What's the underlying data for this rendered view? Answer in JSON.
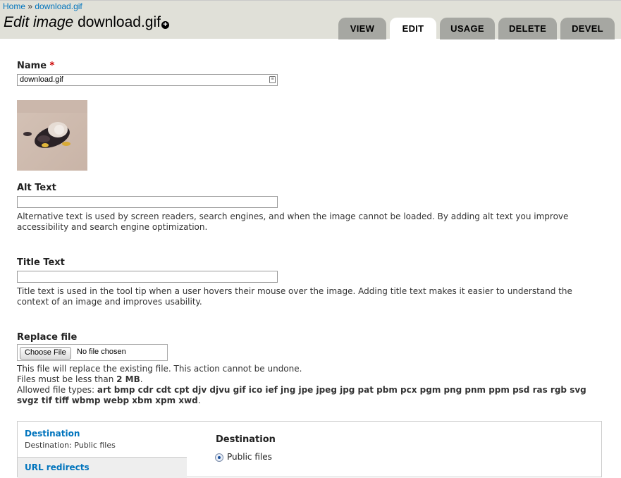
{
  "breadcrumb": {
    "home": "Home",
    "separator": " » ",
    "current": "download.gif"
  },
  "title": {
    "prefix": "Edit image",
    "name": "download.gif",
    "shortcut_symbol": "+"
  },
  "tabs": [
    {
      "label": "VIEW",
      "active": false
    },
    {
      "label": "EDIT",
      "active": true
    },
    {
      "label": "USAGE",
      "active": false
    },
    {
      "label": "DELETE",
      "active": false
    },
    {
      "label": "DEVEL",
      "active": false
    }
  ],
  "name_field": {
    "label": "Name",
    "required_mark": "*",
    "value": "download.gif",
    "icon": "contact-card-icon"
  },
  "alt_field": {
    "label": "Alt Text",
    "value": "",
    "description": "Alternative text is used by screen readers, search engines, and when the image cannot be loaded. By adding alt text you improve accessibility and search engine optimization."
  },
  "title_field": {
    "label": "Title Text",
    "value": "",
    "description": "Title text is used in the tool tip when a user hovers their mouse over the image. Adding title text makes it easier to understand the context of an image and improves usability."
  },
  "replace_file": {
    "label": "Replace file",
    "button": "Choose File",
    "status": "No file chosen",
    "help_line1": "This file will replace the existing file. This action cannot be undone.",
    "help_size_prefix": "Files must be less than ",
    "help_size_value": "2 MB",
    "help_size_suffix": ".",
    "help_types_prefix": "Allowed file types: ",
    "help_types_value": "art bmp cdr cdt cpt djv djvu gif ico ief jng jpe jpeg jpg pat pbm pcx pgm png pnm ppm psd ras rgb svg svgz tif tiff wbmp webp xbm xpm xwd",
    "help_types_suffix": "."
  },
  "vertical_tabs": {
    "items": [
      {
        "title": "Destination",
        "summary": "Destination: Public files"
      },
      {
        "title": "URL redirects",
        "summary": ""
      }
    ],
    "pane_title": "Destination",
    "option_label": "Public files",
    "option_selected": true
  },
  "colors": {
    "link": "#0074bd",
    "header_bg": "#e0e0d8",
    "tab_bg": "#a6a7a2",
    "required": "#cc0000"
  }
}
